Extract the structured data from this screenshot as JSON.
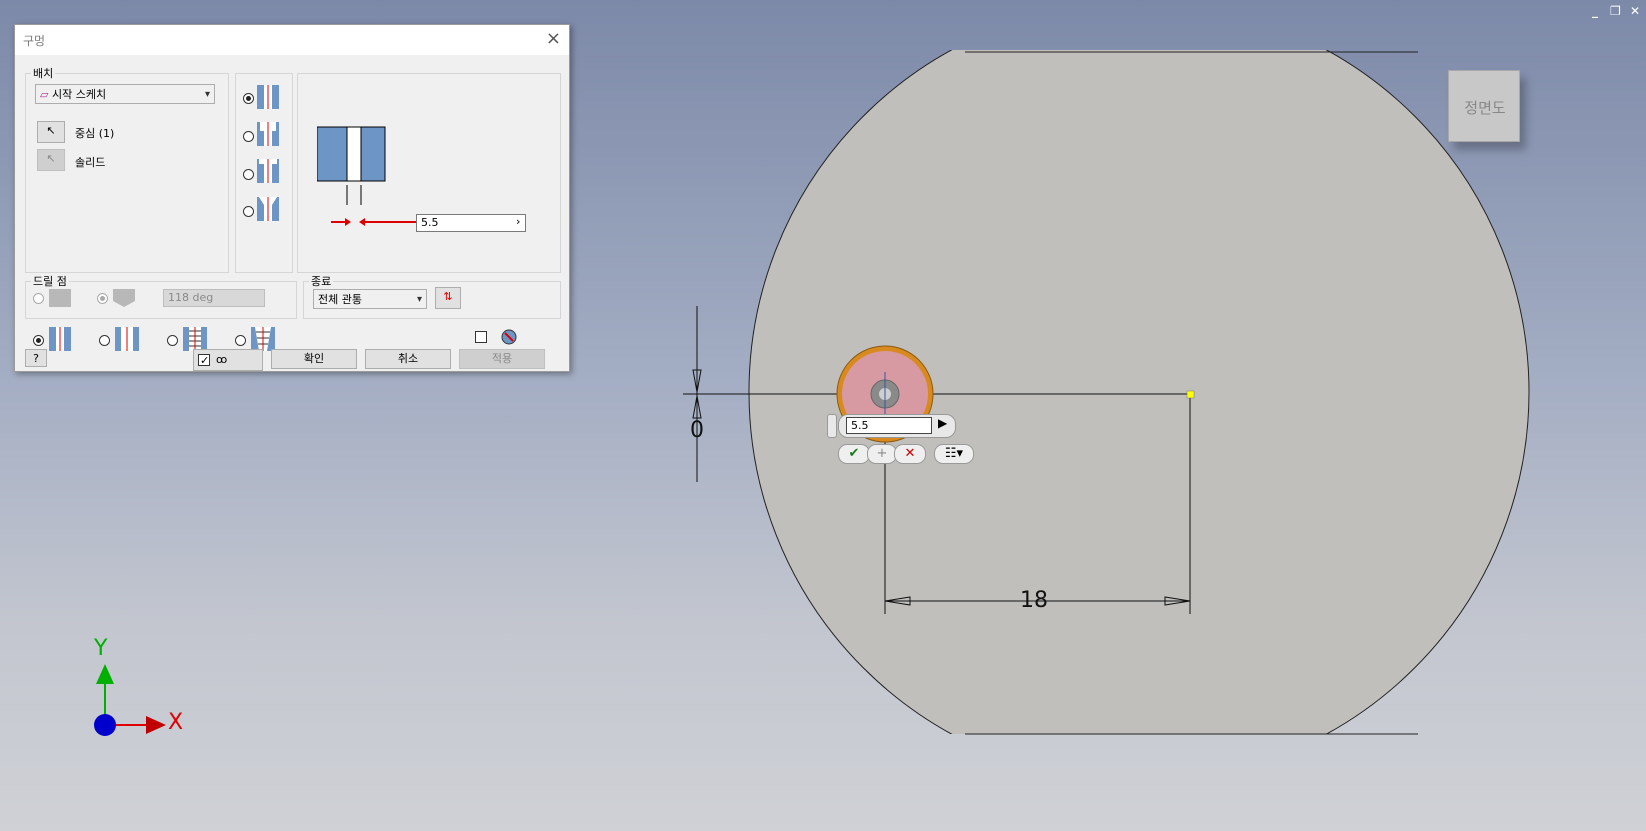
{
  "window_controls": {
    "minimize": "_",
    "restore": "❐",
    "close": "✕"
  },
  "dialog": {
    "title": "구멍",
    "placement": {
      "label": "배치",
      "sketch_combo": "시작 스케치",
      "center_label": "중심 (1)",
      "solid_label": "솔리드"
    },
    "diameter_value": "5.5",
    "drill_point": {
      "label": "드릴 점",
      "angle": "118 deg"
    },
    "termination": {
      "label": "종료",
      "value": "전체 관통"
    },
    "buttons": {
      "ok": "확인",
      "cancel": "취소",
      "apply": "적용"
    }
  },
  "viewport": {
    "view_cube_label": "정면도",
    "dimension_vertical": "0",
    "dimension_horizontal": "18",
    "mini_toolbar_value": "5.5",
    "axis_x": "X",
    "axis_y": "Y"
  },
  "colors": {
    "part_face": "#c0bfbb",
    "hole_fill": "#d79aa2",
    "hole_ring": "#d98a1e",
    "axis_x": "#e00000",
    "axis_y": "#00b000",
    "axis_origin": "#0000cc"
  }
}
